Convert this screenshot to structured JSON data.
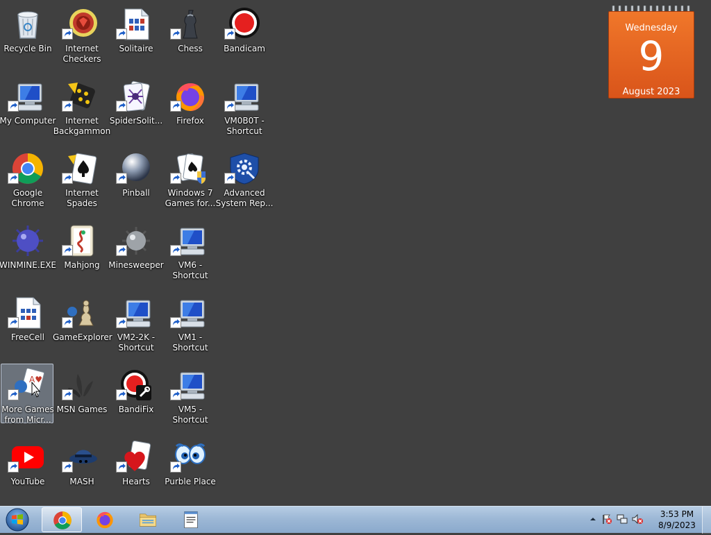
{
  "desktop": {
    "icons": [
      {
        "label": "Recycle Bin",
        "icon": "recycle-bin-icon"
      },
      {
        "label": "Internet Checkers",
        "icon": "checkers-icon"
      },
      {
        "label": "Solitaire",
        "icon": "solitaire-icon"
      },
      {
        "label": "Chess",
        "icon": "chess-icon"
      },
      {
        "label": "Bandicam",
        "icon": "bandicam-icon"
      },
      {
        "label": "My Computer",
        "icon": "computer-icon"
      },
      {
        "label": "Internet Backgammon",
        "icon": "backgammon-icon"
      },
      {
        "label": "SpiderSolit...",
        "icon": "spider-solitaire-icon"
      },
      {
        "label": "Firefox",
        "icon": "firefox-icon"
      },
      {
        "label": "VM0B0T - Shortcut",
        "icon": "computer-icon"
      },
      {
        "label": "Google Chrome",
        "icon": "chrome-icon"
      },
      {
        "label": "Internet Spades",
        "icon": "spades-icon"
      },
      {
        "label": "Pinball",
        "icon": "pinball-icon"
      },
      {
        "label": "Windows 7 Games for...",
        "icon": "cards-shield-icon"
      },
      {
        "label": "Advanced System Rep...",
        "icon": "shield-gear-icon"
      },
      {
        "label": "WINMINE.EXE",
        "icon": "mine-icon"
      },
      {
        "label": "Mahjong",
        "icon": "mahjong-icon"
      },
      {
        "label": "Minesweeper",
        "icon": "minesweeper-icon"
      },
      {
        "label": "VM6 - Shortcut",
        "icon": "computer-icon"
      },
      {
        "label": "FreeCell",
        "icon": "freecell-icon"
      },
      {
        "label": "GameExplorer",
        "icon": "game-explorer-icon"
      },
      {
        "label": "VM2-2K - Shortcut",
        "icon": "computer-icon"
      },
      {
        "label": "VM1 - Shortcut",
        "icon": "computer-icon"
      },
      {
        "label": "More Games from Micr...",
        "icon": "more-games-icon"
      },
      {
        "label": "MSN Games",
        "icon": "msn-games-icon"
      },
      {
        "label": "BandiFix",
        "icon": "bandifix-icon"
      },
      {
        "label": "VM5 - Shortcut",
        "icon": "computer-icon"
      },
      {
        "label": "YouTube",
        "icon": "youtube-icon"
      },
      {
        "label": "MASH",
        "icon": "mash-icon"
      },
      {
        "label": "Hearts",
        "icon": "hearts-icon"
      },
      {
        "label": "Purble Place",
        "icon": "purble-place-icon"
      }
    ]
  },
  "calendar": {
    "weekday": "Wednesday",
    "day": "9",
    "month_year": "August 2023"
  },
  "taskbar": {
    "items": [
      "chrome-icon",
      "firefox-icon",
      "folder-icon",
      "notepad-icon"
    ],
    "clock": {
      "time": "3:53 PM",
      "date": "8/9/2023"
    }
  },
  "colors": {
    "desktop_bg": "#404040",
    "calendar_orange": "#e8641f",
    "taskbar_blue": "#9db8d6"
  }
}
